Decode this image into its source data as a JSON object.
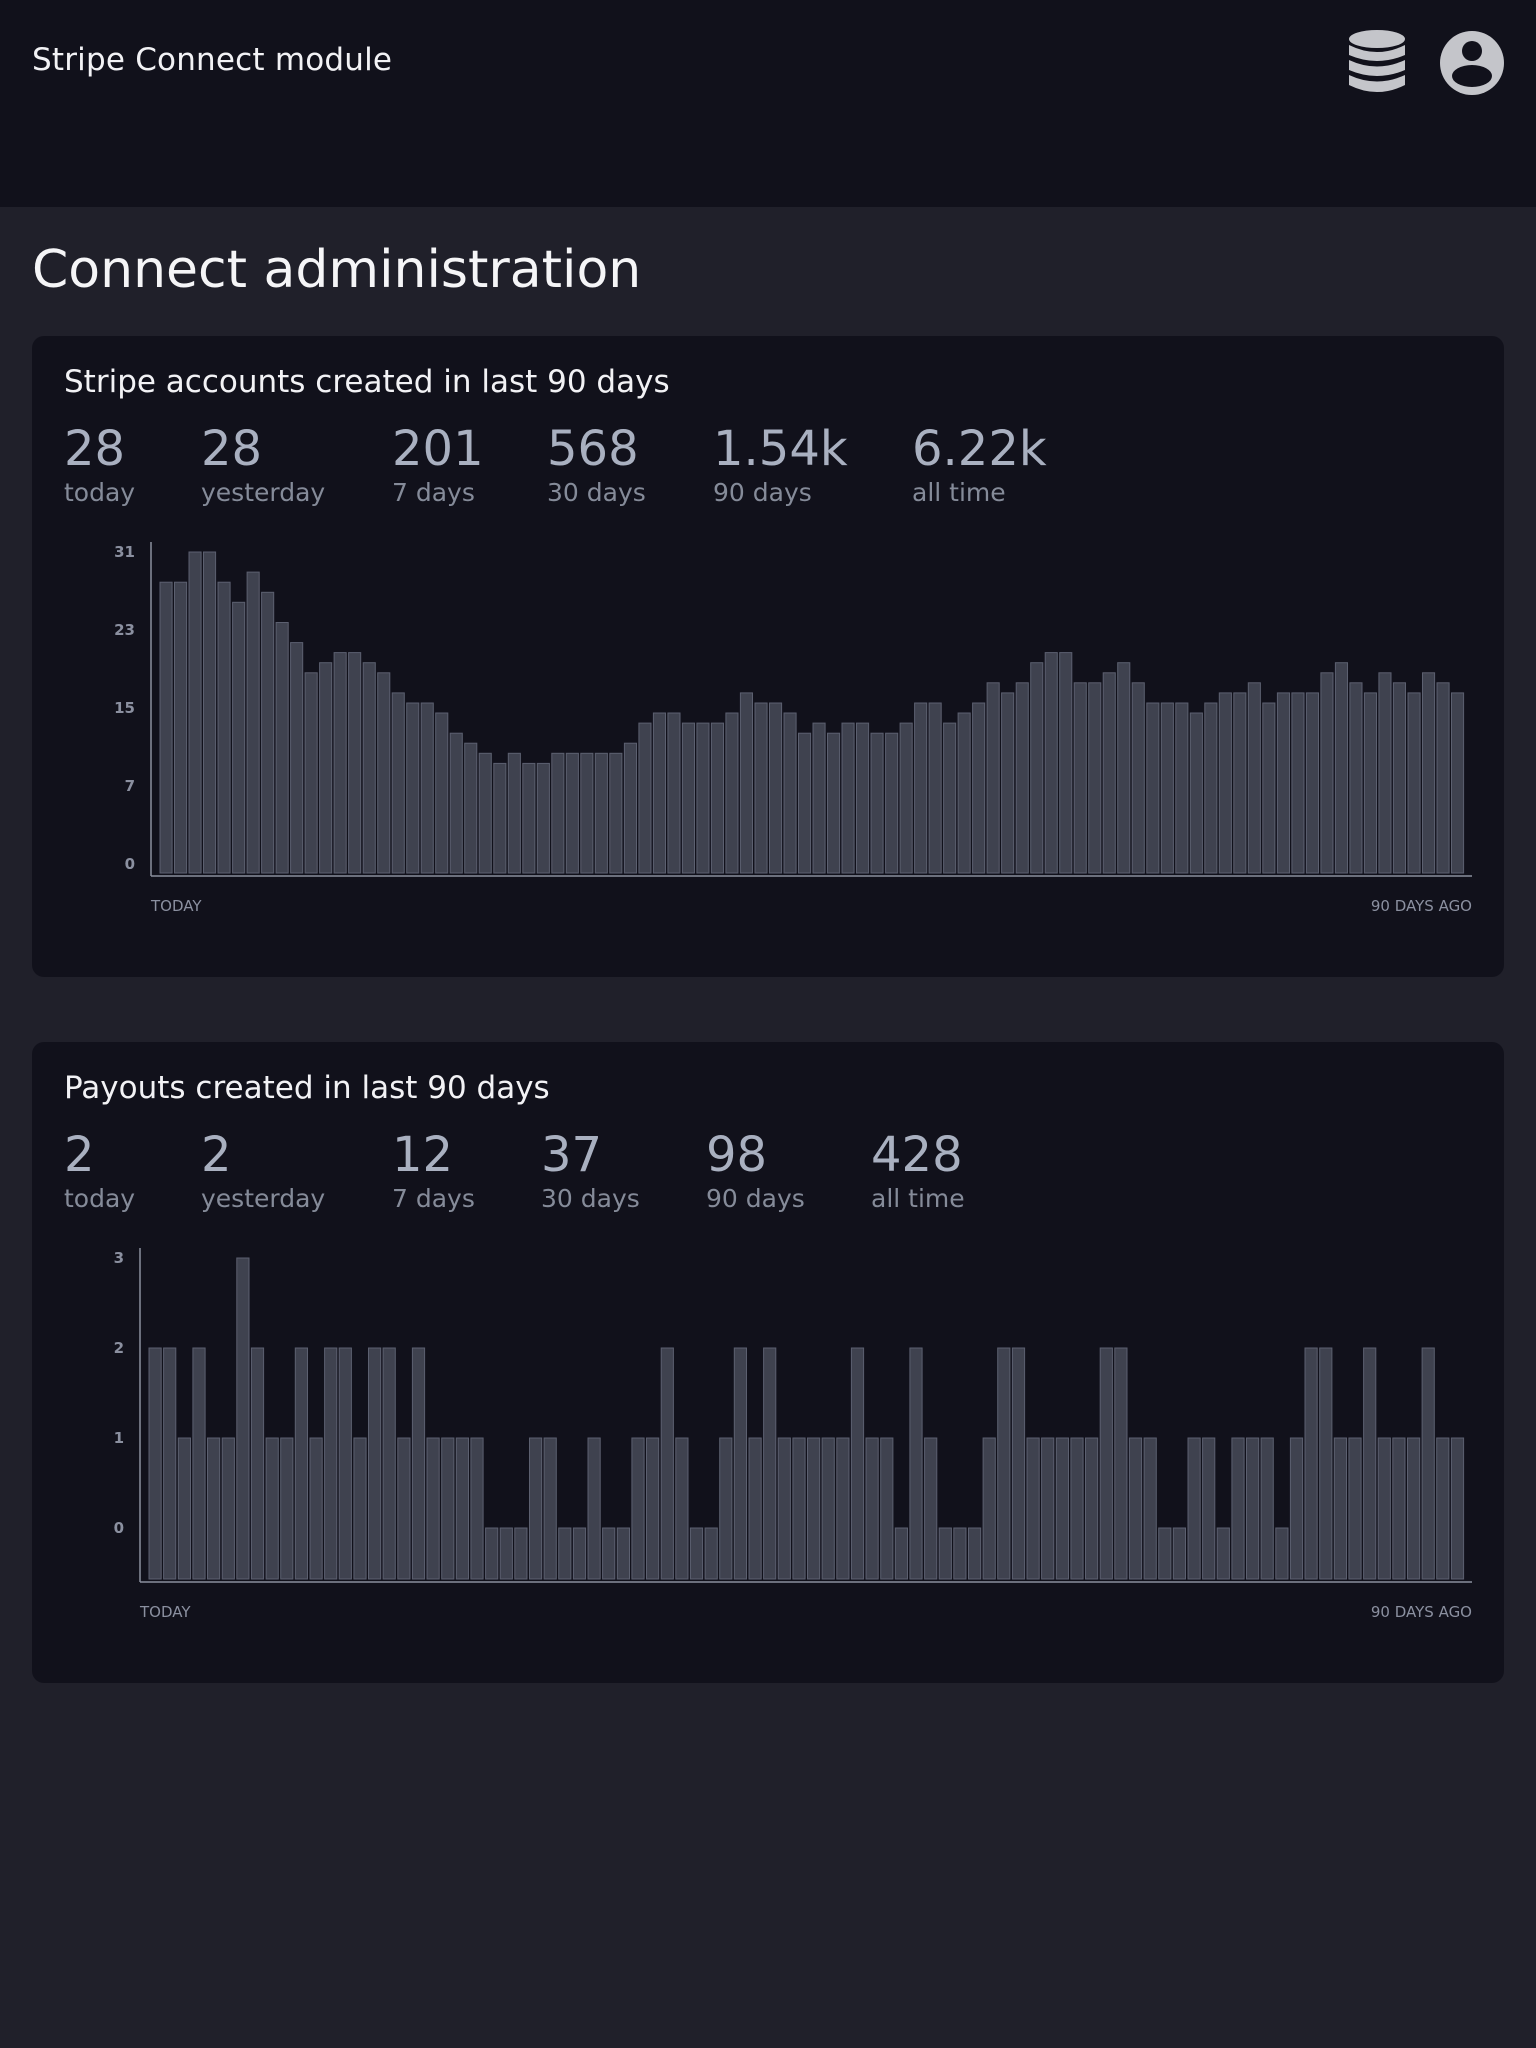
{
  "header": {
    "app_title": "Stripe Connect module",
    "icons": [
      "database-icon",
      "user-account-icon"
    ]
  },
  "page": {
    "title": "Connect administration"
  },
  "cards": [
    {
      "title": "Stripe accounts created in last 90 days",
      "stats": [
        {
          "value": "28",
          "label": "today"
        },
        {
          "value": "28",
          "label": "yesterday"
        },
        {
          "value": "201",
          "label": "7 days"
        },
        {
          "value": "568",
          "label": "30 days"
        },
        {
          "value": "1.54k",
          "label": "90 days"
        },
        {
          "value": "6.22k",
          "label": "all time"
        }
      ]
    },
    {
      "title": "Payouts created in last 90 days",
      "stats": [
        {
          "value": "2",
          "label": "today"
        },
        {
          "value": "2",
          "label": "yesterday"
        },
        {
          "value": "12",
          "label": "7 days"
        },
        {
          "value": "37",
          "label": "30 days"
        },
        {
          "value": "98",
          "label": "90 days"
        },
        {
          "value": "428",
          "label": "all time"
        }
      ]
    }
  ],
  "chart_data": [
    {
      "type": "bar",
      "title": "Stripe accounts created in last 90 days",
      "yticks": [
        "31",
        "23",
        "15",
        "7",
        "0"
      ],
      "ylim": [
        0,
        31
      ],
      "x_start_label": "TODAY",
      "x_end_label": "90 DAYS AGO",
      "values": [
        28,
        28,
        31,
        31,
        28,
        26,
        29,
        27,
        24,
        22,
        19,
        20,
        21,
        21,
        20,
        19,
        17,
        16,
        16,
        15,
        13,
        12,
        11,
        10,
        11,
        10,
        10,
        11,
        11,
        11,
        11,
        11,
        12,
        14,
        15,
        15,
        14,
        14,
        14,
        15,
        17,
        16,
        16,
        15,
        13,
        14,
        13,
        14,
        14,
        13,
        13,
        14,
        16,
        16,
        14,
        15,
        16,
        18,
        17,
        18,
        20,
        21,
        21,
        18,
        18,
        19,
        20,
        18,
        16,
        16,
        16,
        15,
        16,
        17,
        17,
        18,
        16,
        17,
        17,
        17,
        19,
        20,
        18,
        17,
        19,
        18,
        17,
        19,
        18,
        17
      ]
    },
    {
      "type": "bar",
      "title": "Payouts created in last 90 days",
      "yticks": [
        "3",
        "2",
        "1",
        "0"
      ],
      "ylim": [
        0,
        3
      ],
      "x_start_label": "TODAY",
      "x_end_label": "90 DAYS AGO",
      "values": [
        2,
        2,
        1,
        2,
        1,
        1,
        3,
        2,
        1,
        1,
        2,
        1,
        2,
        2,
        1,
        2,
        2,
        1,
        2,
        1,
        1,
        1,
        1,
        0,
        0,
        0,
        1,
        1,
        0,
        0,
        1,
        0,
        0,
        1,
        1,
        2,
        1,
        0,
        0,
        1,
        2,
        1,
        2,
        1,
        1,
        1,
        1,
        1,
        2,
        1,
        1,
        0,
        2,
        1,
        0,
        0,
        0,
        1,
        2,
        2,
        1,
        1,
        1,
        1,
        1,
        2,
        2,
        1,
        1,
        0,
        0,
        1,
        1,
        0,
        1,
        1,
        1,
        0,
        1,
        2,
        2,
        1,
        1,
        2,
        1,
        1,
        1,
        2,
        1,
        1
      ]
    }
  ]
}
